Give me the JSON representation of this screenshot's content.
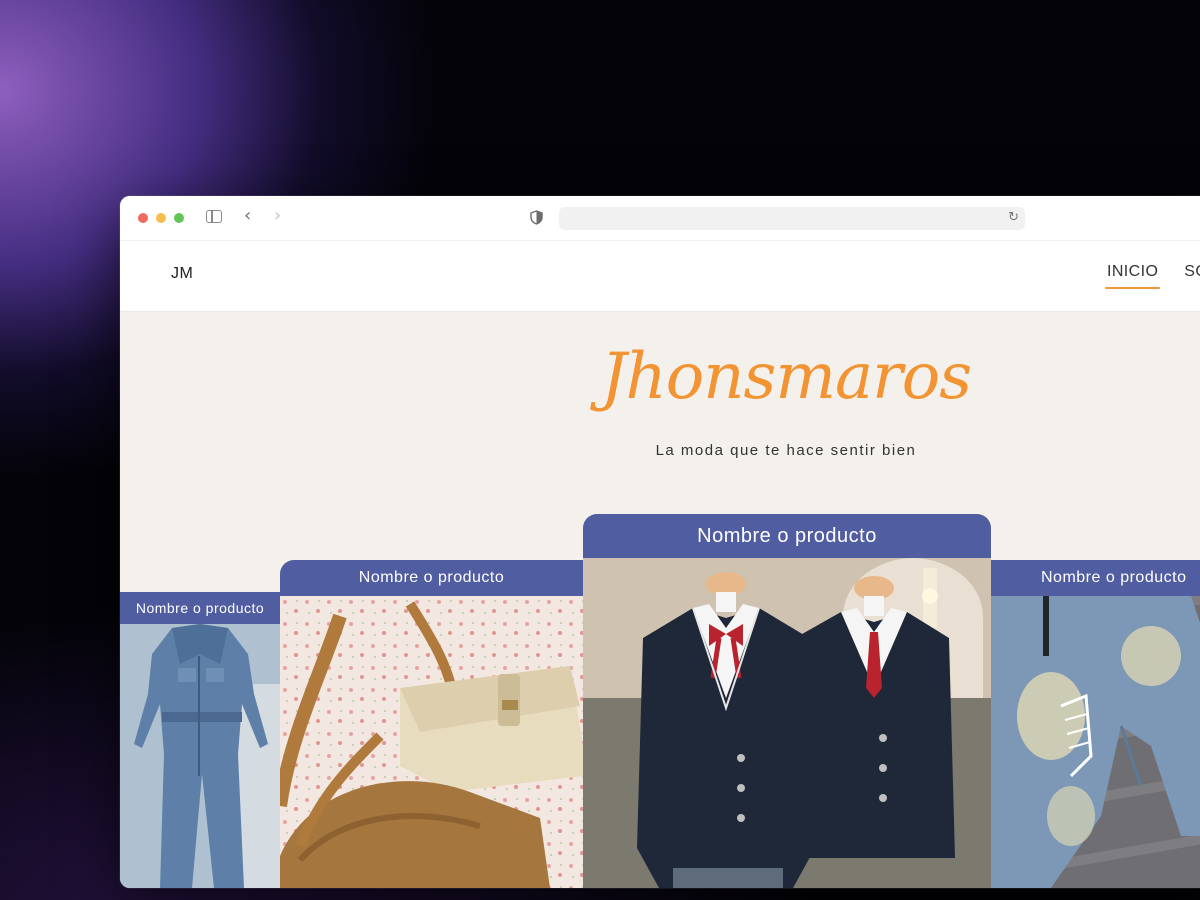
{
  "browser": {
    "controls": [
      "close-dot",
      "minimize-dot",
      "zoom-dot"
    ],
    "back_glyph": "‹",
    "forward_glyph": "›",
    "reload_glyph": "↻",
    "address_value": ""
  },
  "site": {
    "logo": "JM",
    "nav": [
      {
        "label": "INICIO",
        "active": true
      },
      {
        "label": "SOBRE",
        "active": false
      }
    ]
  },
  "hero": {
    "brand": "Jhonsmaros",
    "tagline": "La moda que te hace sentir bien"
  },
  "products": [
    {
      "label": "Nombre o producto",
      "image": "denim-jumpsuit"
    },
    {
      "label": "Nombre o producto",
      "image": "canvas-bags"
    },
    {
      "label": "Nombre o producto",
      "image": "school-uniforms"
    },
    {
      "label": "Nombre o producto",
      "image": "distressed-jeans"
    }
  ],
  "colors": {
    "accent": "#f29433",
    "label_bg": "#3a4896",
    "hero_bg": "#f4f1ec"
  }
}
